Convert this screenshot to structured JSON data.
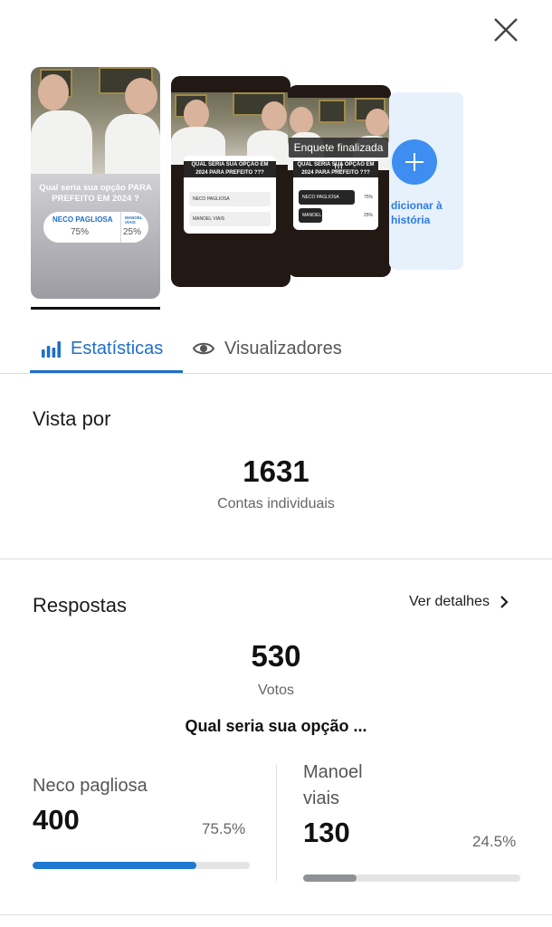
{
  "close_icon": "close-icon",
  "stories": {
    "first": {
      "question": "Qual seria sua opção PARA PREFEITO EM 2024 ?",
      "option_a_name": "NECO PAGLIOSA",
      "option_a_pct": "75%",
      "option_b_name": "MANOEL VIAIS",
      "option_b_pct": "25%"
    },
    "second": {
      "question": "QUAL SERIA SUA OPÇÃO EM 2024 PARA PREFEITO ???",
      "option_a": "NECO PAGLIOSA",
      "option_b": "MANOEL VIAIS"
    },
    "third": {
      "tag": "Enquete finalizada !!!",
      "question": "QUAL SERIA SUA OPÇÃO EM 2024 PARA PREFEITO ???",
      "option_a": "NECO PAGLIOSA",
      "option_a_pct": "75%",
      "option_b": "MANOEL VIAIS",
      "option_b_pct": "25%"
    },
    "add_label": "dicionar à história"
  },
  "tabs": {
    "stats_label": "Estatísticas",
    "viewers_label": "Visualizadores",
    "active": "stats"
  },
  "views": {
    "title": "Vista por",
    "count": "1631",
    "count_label": "Contas individuais"
  },
  "responses": {
    "title": "Respostas",
    "details_label": "Ver detalhes",
    "votes": "530",
    "votes_label": "Votos",
    "question": "Qual seria sua opção ...",
    "options": [
      {
        "name": "Neco pagliosa",
        "votes": "400",
        "pct_label": "75.5%",
        "fraction": 0.755,
        "color": "#1f78d1"
      },
      {
        "name": "Manoel viais",
        "votes": "130",
        "pct_label": "24.5%",
        "fraction": 0.245,
        "color": "#8e9297"
      }
    ]
  },
  "colors": {
    "accent": "#1f6fc5",
    "divider": "#dedede"
  }
}
